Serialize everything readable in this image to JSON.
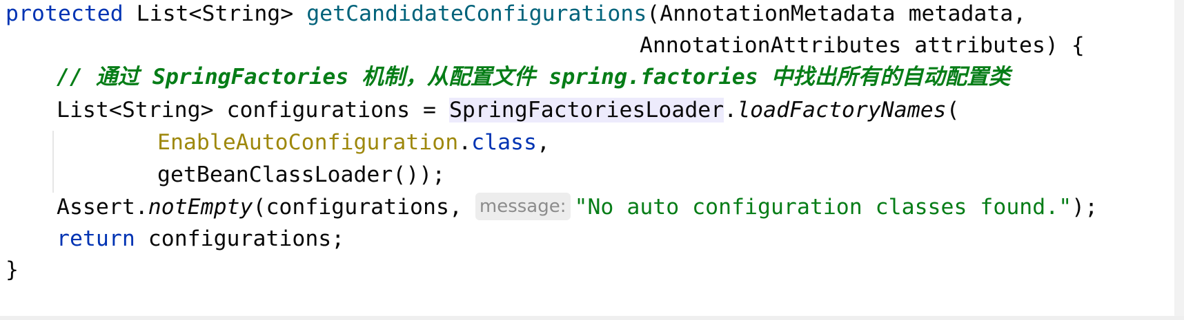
{
  "editor": {
    "line1": {
      "modifier": "protected",
      "return_type": "List<String>",
      "method_name": "getCandidateConfigurations",
      "params_start": "(AnnotationMetadata metadata,"
    },
    "line2": {
      "params_end": "AnnotationAttributes attributes) {"
    },
    "line3": {
      "comment": "// 通过 SpringFactories 机制，从配置文件 spring.factories 中找出所有的自动配置类"
    },
    "line4": {
      "decl": "List<String> configurations = ",
      "loader_class": "SpringFactoriesLoader",
      "dot": ".",
      "load_method": "loadFactoryNames",
      "open_paren": "("
    },
    "line5": {
      "annotation_class": "EnableAutoConfiguration",
      "dot": ".",
      "class_keyword": "class",
      "comma": ","
    },
    "line6": {
      "text": "getBeanClassLoader());"
    },
    "line7": {
      "assert_class": "Assert",
      "dot": ".",
      "assert_method": "notEmpty",
      "args_start": "(configurations, ",
      "param_hint": "message:",
      "message_string": "\"No auto configuration classes found.\"",
      "end": ");"
    },
    "line8": {
      "return_keyword": "return",
      "return_value": " configurations;"
    },
    "line9": {
      "closing_brace": "}"
    }
  },
  "colors": {
    "keyword": "#0033b3",
    "method_declaration": "#00627a",
    "comment": "#067d17",
    "string": "#067d17",
    "annotation_class": "#9e880d",
    "highlight_background": "#edebfc",
    "hint_background": "#ededed",
    "hint_text": "#8c8c8c"
  }
}
